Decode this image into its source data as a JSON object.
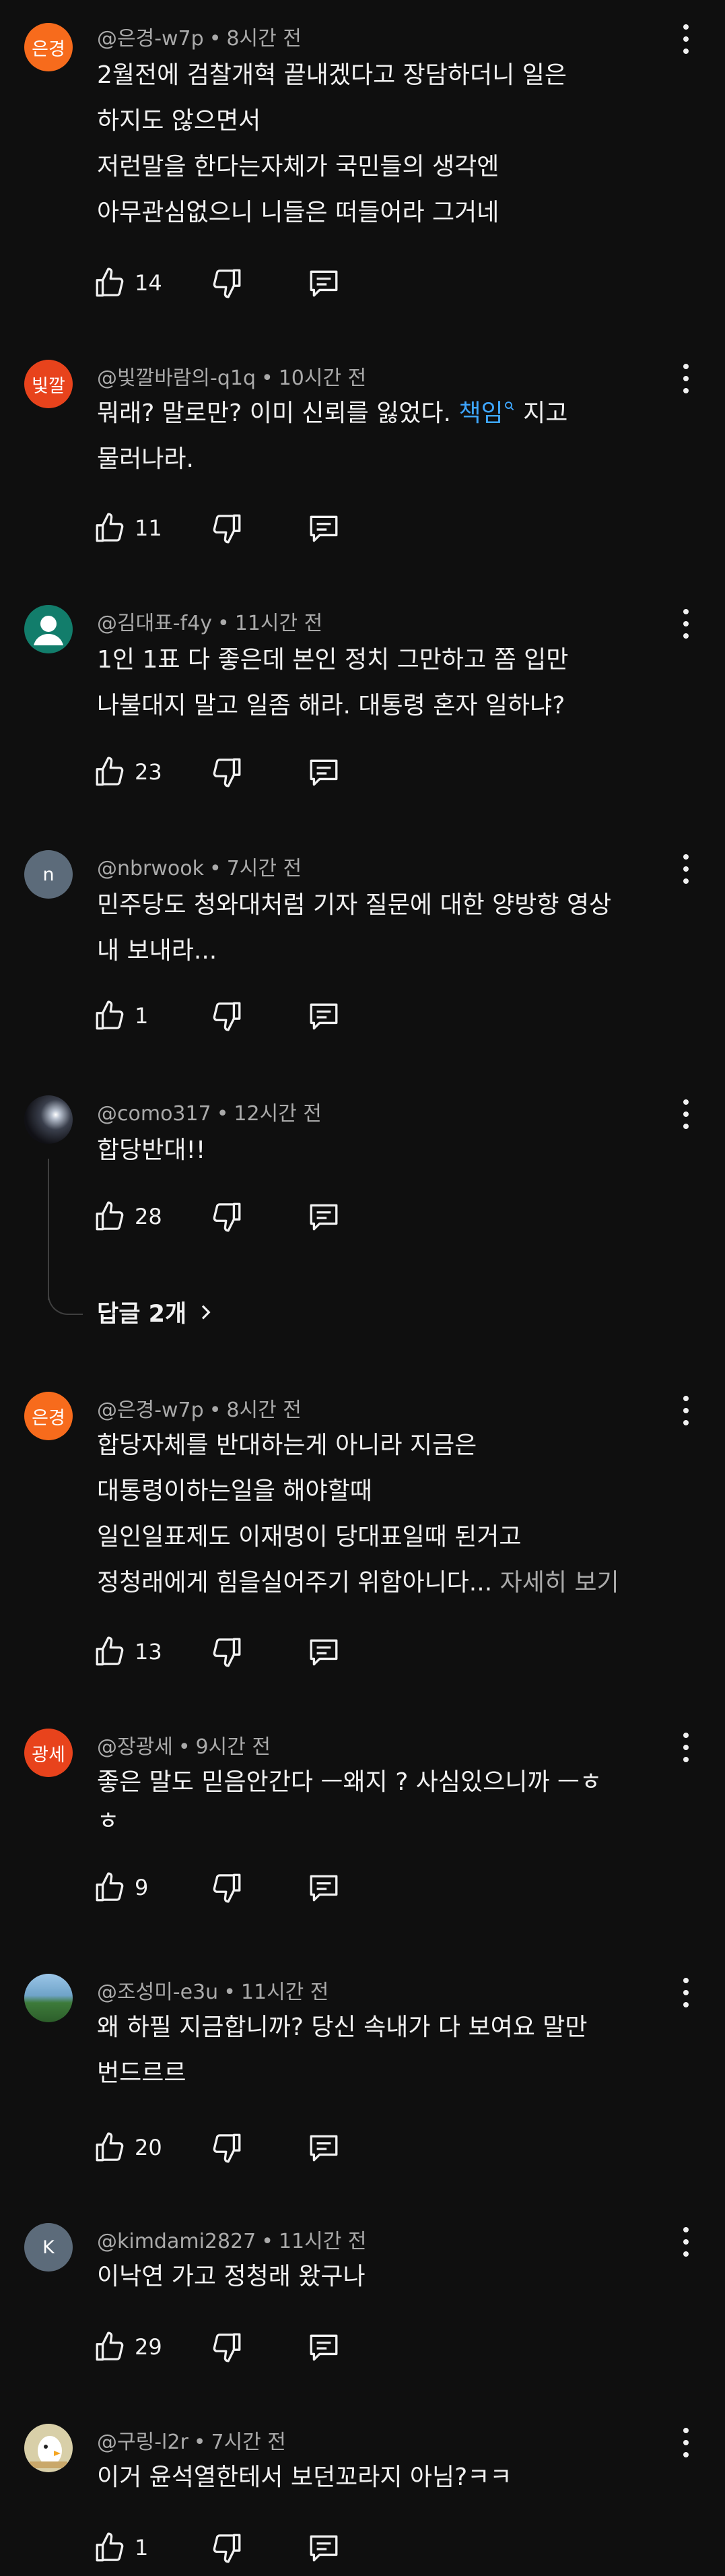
{
  "comments": [
    {
      "avatar_text": "은경",
      "avatar_color": "#f76b1c",
      "author": "@은경-w7p",
      "time": "8시간 전",
      "lines": [
        "2월전에 검찰개혁 끝내겠다고 장담하더니 일은",
        "하지도 않으면서",
        "저런말을 한다는자체가 국민들의 생각엔",
        "아무관심없으니 니들은 떠들어라 그거네"
      ],
      "likes": "14"
    },
    {
      "avatar_text": "빛깔",
      "avatar_color": "#e8431c",
      "author": "@빛깔바람의-q1q",
      "time": "10시간 전",
      "line1_before": "뭐래? 말로만?  이미 신뢰를 잃었다. ",
      "line1_link": "책임",
      "line1_after": " 지고",
      "lines": [
        "물러나라."
      ],
      "likes": "11"
    },
    {
      "avatar_text": "",
      "avatar_color": "#127d6b",
      "author": "@김대표-f4y",
      "time": "11시간 전",
      "lines": [
        "1인 1표 다 좋은데 본인 정치 그만하고 쫌 입만",
        "나불대지 말고 일좀 해라. 대통령 혼자 일하냐?"
      ],
      "likes": "23"
    },
    {
      "avatar_text": "n",
      "avatar_color": "#5c6b7a",
      "author": "@nbrwook",
      "time": "7시간 전",
      "lines": [
        "민주당도 청와대처럼 기자 질문에 대한 양방향 영상",
        "내 보내라..."
      ],
      "likes": "1"
    },
    {
      "avatar_text": "",
      "avatar_color": "#1a1a1a",
      "author": "@como317",
      "time": "12시간 전",
      "lines": [
        "합당반대!!"
      ],
      "likes": "28",
      "replies_label": "답글 2개"
    },
    {
      "avatar_text": "은경",
      "avatar_color": "#f76b1c",
      "author": "@은경-w7p",
      "time": "8시간 전",
      "lines": [
        "합당자체를 반대하는게 아니라 지금은",
        "대통령이하는일을 해야할때",
        "일인일표제도 이재명이 당대표일때 된거고"
      ],
      "last_line": "정청래에게 힘을실어주기 위함아니다... ",
      "see_all": "자세히 보기",
      "likes": "13"
    },
    {
      "avatar_text": "광세",
      "avatar_color": "#e8431c",
      "author": "@장광세",
      "time": "9시간 전",
      "lines": [
        "좋은 말도 믿음안간다   ㅡ왜지 ? 사심있으니까 ㅡㅎ",
        "ㅎ"
      ],
      "likes": "9"
    },
    {
      "avatar_text": "",
      "avatar_color": "#6fa3c8",
      "author": "@조성미-e3u",
      "time": "11시간 전",
      "lines": [
        "왜 하필 지금합니까? 당신 속내가 다 보여요 말만",
        "번드르르"
      ],
      "likes": "20"
    },
    {
      "avatar_text": "K",
      "avatar_color": "#5c6b7a",
      "author": "@kimdami2827",
      "time": "11시간 전",
      "lines": [
        "이낙연 가고 정청래 왔구나"
      ],
      "likes": "29"
    },
    {
      "avatar_text": "",
      "avatar_color": "#d8cfa8",
      "author": "@구링-l2r",
      "time": "7시간 전",
      "lines": [
        "이거 윤석열한테서 보던꼬라지 아님?ㅋㅋ"
      ],
      "likes": "1"
    }
  ]
}
